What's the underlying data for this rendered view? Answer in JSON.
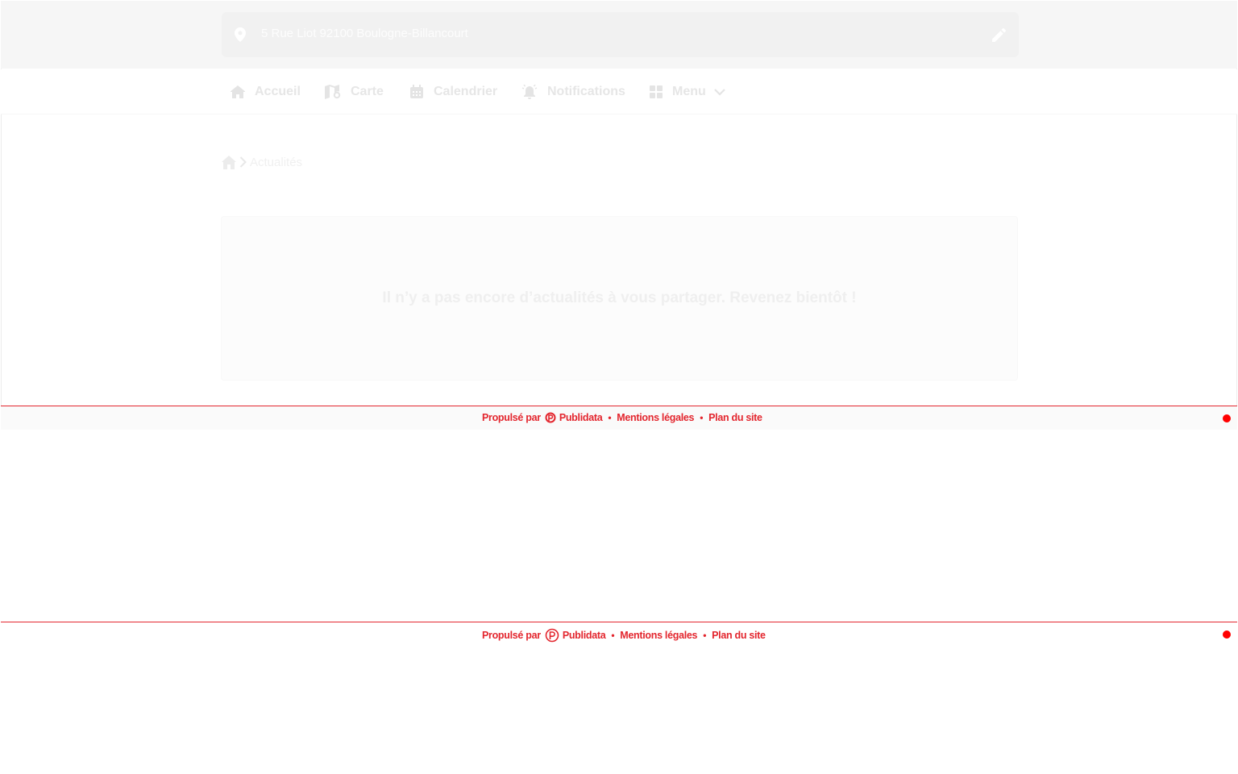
{
  "header": {
    "address": "5 Rue Liot 92100 Boulogne-Billancourt",
    "location_icon": "map-pin-icon",
    "edit_icon": "pencil-icon"
  },
  "nav": {
    "items": [
      {
        "label": "Accueil",
        "icon": "home-icon"
      },
      {
        "label": "Carte",
        "icon": "map-icon"
      },
      {
        "label": "Calendrier",
        "icon": "calendar-icon"
      },
      {
        "label": "Notifications",
        "icon": "bell-icon"
      },
      {
        "label": "Menu",
        "icon": "grid-icon",
        "has_dropdown": true
      }
    ]
  },
  "breadcrumb": {
    "home_icon": "home-icon",
    "separator_icon": "chevron-right-icon",
    "current": "Actualités"
  },
  "main": {
    "empty_message": "Il n’y a pas encore d’actualités à vous partager. Revenez bientôt !"
  },
  "footer": {
    "powered_by": "Propulsé par",
    "brand": "Publidata",
    "legal": "Mentions légales",
    "sitemap": "Plan du site",
    "separator": "•"
  },
  "colors": {
    "accent": "#e3262e",
    "status_dot": "#ff0000"
  }
}
